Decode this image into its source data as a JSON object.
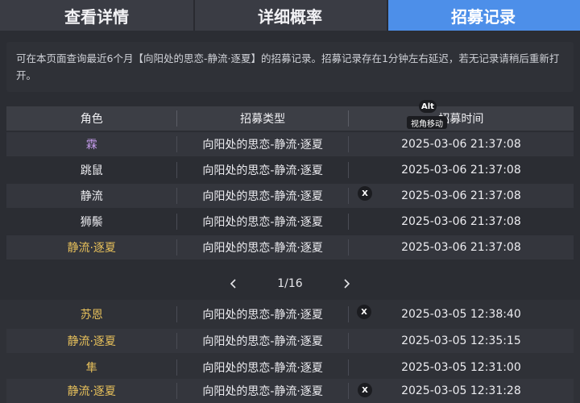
{
  "tabs": [
    "查看详情",
    "详细概率",
    "招募记录"
  ],
  "notice": "可在本页面查询最近6个月【向阳处的思恋-静流·逐夏】的招募记录。招募记录存在1分钟左右延迟，若无记录请稍后重新打开。",
  "table": {
    "headers": [
      "角色",
      "招募类型",
      "招募时间"
    ],
    "rows": [
      {
        "name": "霖",
        "type": "向阳处的思恋-静流·逐夏",
        "time": "2025-03-06 21:37:08",
        "color": "#c39bea"
      },
      {
        "name": "跳鼠",
        "type": "向阳处的思恋-静流·逐夏",
        "time": "2025-03-06 21:37:08",
        "color": "#ececf0"
      },
      {
        "name": "静流",
        "type": "向阳处的思恋-静流·逐夏",
        "time": "2025-03-06 21:37:08",
        "color": "#ececf0"
      },
      {
        "name": "狮鬃",
        "type": "向阳处的思恋-静流·逐夏",
        "time": "2025-03-06 21:37:08",
        "color": "#ececf0"
      },
      {
        "name": "静流·逐夏",
        "type": "向阳处的思恋-静流·逐夏",
        "time": "2025-03-06 21:37:08",
        "color": "#e8c15b"
      }
    ],
    "lower_rows": [
      {
        "name": "苏恩",
        "type": "向阳处的思恋-静流·逐夏",
        "time": "2025-03-05 12:38:40",
        "color": "#e8c15b"
      },
      {
        "name": "静流·逐夏",
        "type": "向阳处的思恋-静流·逐夏",
        "time": "2025-03-05 12:35:15",
        "color": "#e8c15b"
      },
      {
        "name": "隼",
        "type": "向阳处的思恋-静流·逐夏",
        "time": "2025-03-05 12:31:00",
        "color": "#e8c15b"
      },
      {
        "name": "静流·逐夏",
        "type": "向阳处的思恋-静流·逐夏",
        "time": "2025-03-05 12:31:28",
        "color": "#e8c15b"
      }
    ]
  },
  "pager": {
    "page": "1/16",
    "prev_icon": "chevron-left-icon",
    "next_icon": "chevron-right-icon"
  },
  "overlay": {
    "alt_key": "Alt",
    "alt_hint": "视角移动",
    "close_mark": "X"
  },
  "colors": {
    "accent": "#4d8fe9",
    "gold": "#e8c15b",
    "purple": "#c39bea"
  }
}
